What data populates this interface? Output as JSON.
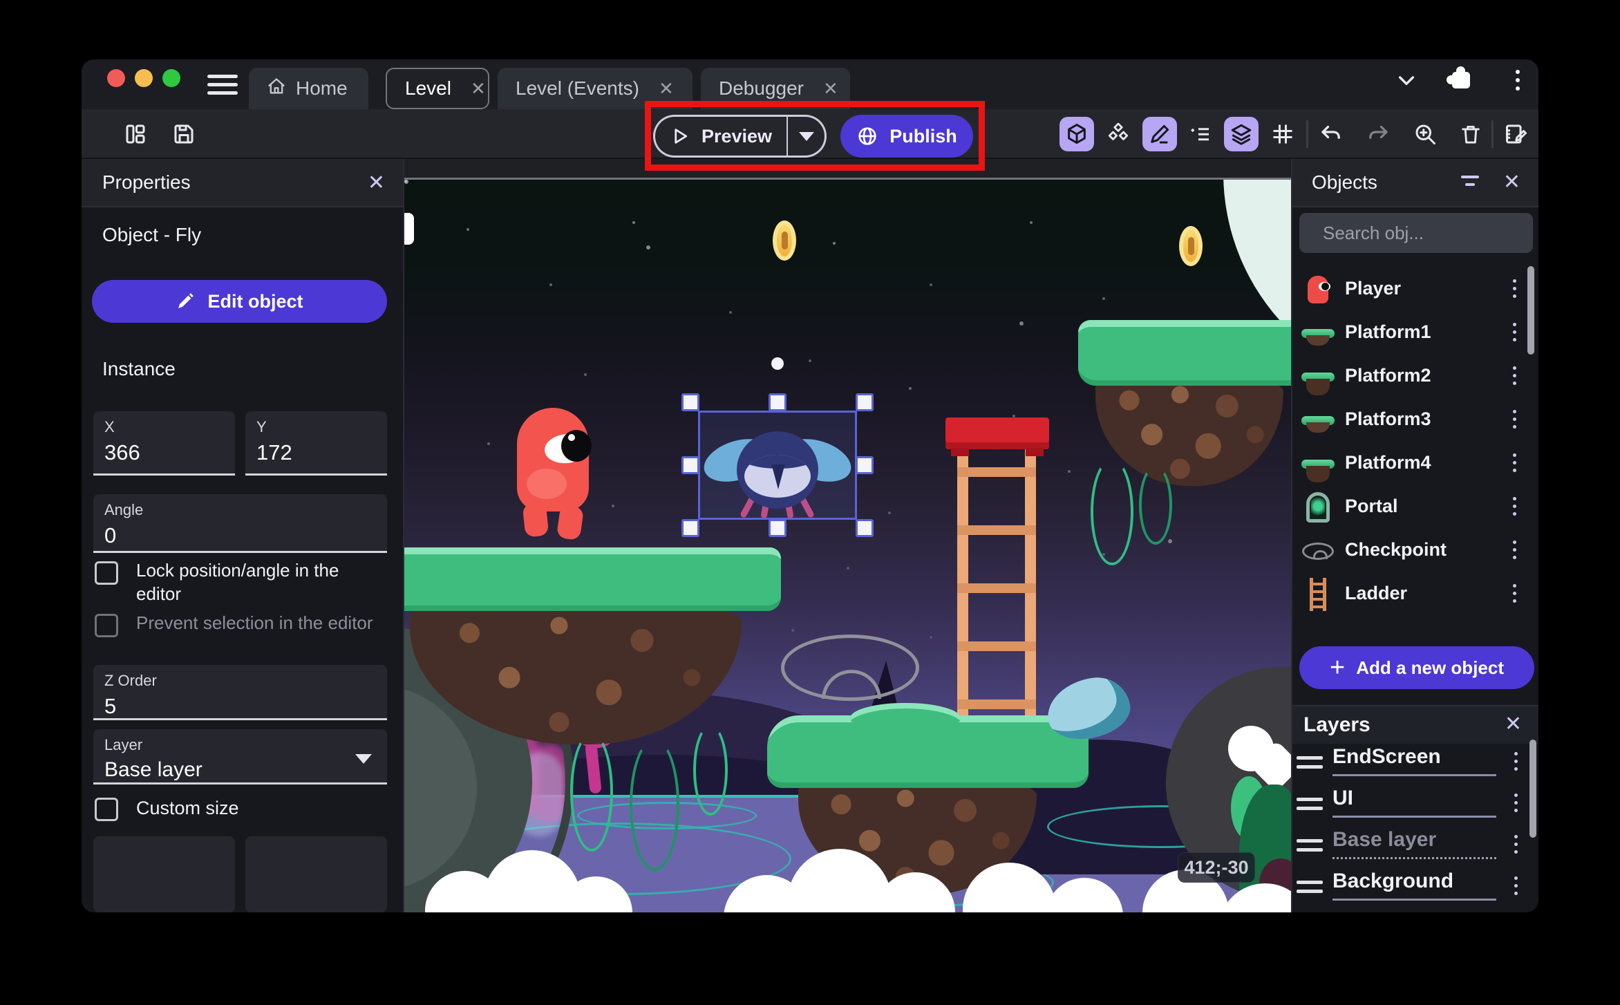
{
  "window": {
    "tabs": [
      {
        "label": "Home"
      },
      {
        "label": "Level"
      },
      {
        "label": "Level (Events)"
      },
      {
        "label": "Debugger"
      }
    ]
  },
  "toolbar": {
    "preview_label": "Preview",
    "publish_label": "Publish"
  },
  "properties_panel": {
    "title": "Properties",
    "object_heading": "Object - Fly",
    "edit_object_label": "Edit object",
    "instance_heading": "Instance",
    "fields": {
      "x": {
        "label": "X",
        "value": "366"
      },
      "y": {
        "label": "Y",
        "value": "172"
      },
      "angle": {
        "label": "Angle",
        "value": "0"
      },
      "z_order": {
        "label": "Z Order",
        "value": "5"
      },
      "layer": {
        "label": "Layer",
        "value": "Base layer"
      }
    },
    "checkboxes": [
      {
        "label": "Lock position/angle in the editor"
      },
      {
        "label": "Prevent selection in the editor"
      },
      {
        "label": "Custom size"
      }
    ]
  },
  "objects_panel": {
    "title": "Objects",
    "search_placeholder": "Search obj...",
    "items": [
      {
        "label": "Player"
      },
      {
        "label": "Platform1"
      },
      {
        "label": "Platform2"
      },
      {
        "label": "Platform3"
      },
      {
        "label": "Platform4"
      },
      {
        "label": "Portal"
      },
      {
        "label": "Checkpoint"
      },
      {
        "label": "Ladder"
      }
    ],
    "add_button_label": "Add a new object"
  },
  "layers_panel": {
    "title": "Layers",
    "layers": [
      {
        "name": "EndScreen"
      },
      {
        "name": "UI"
      },
      {
        "name": "Base layer"
      },
      {
        "name": "Background"
      }
    ]
  },
  "canvas": {
    "coordinates_badge": "412;-30"
  },
  "colors": {
    "accent_purple": "#4C38D4",
    "annotation_red": "#EB1414",
    "active_icon_bg": "#B6A6F3",
    "selection_blue": "#5A64D8"
  }
}
